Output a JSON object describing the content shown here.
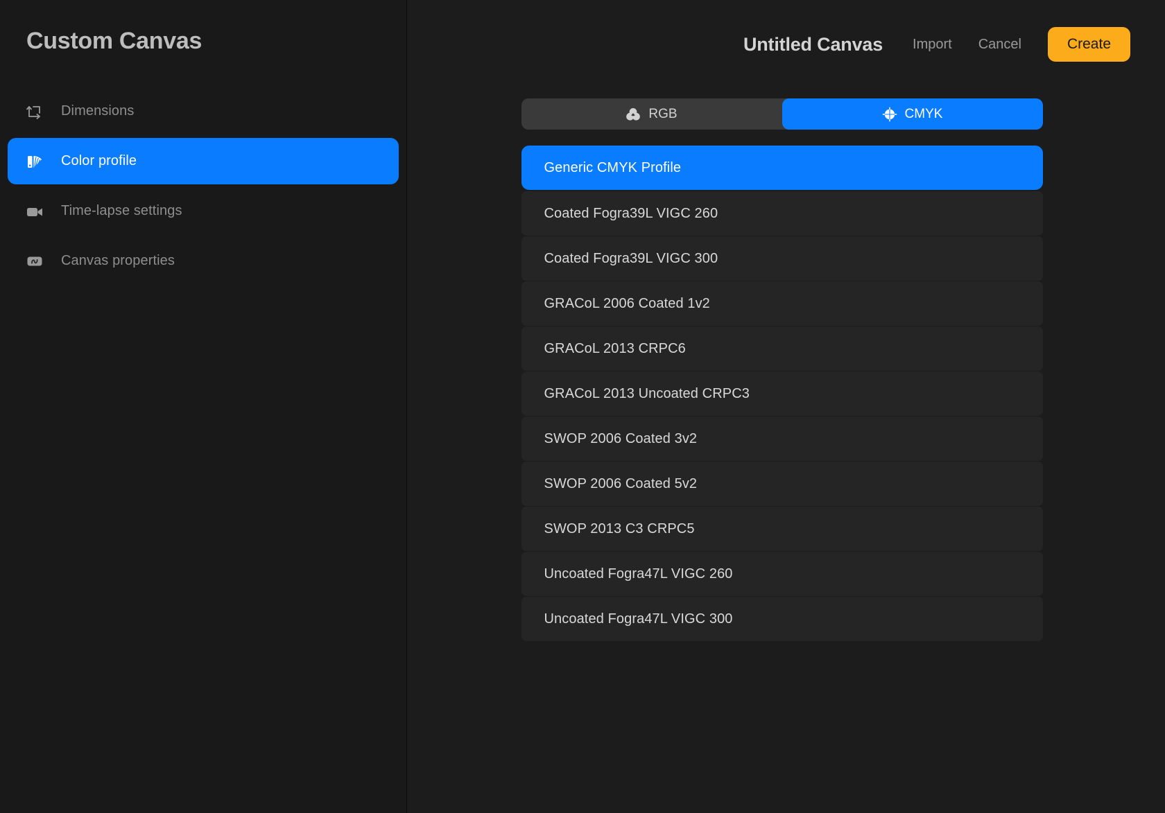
{
  "sidebar": {
    "title": "Custom Canvas",
    "items": [
      {
        "label": "Dimensions",
        "icon": "dimensions-icon",
        "active": false
      },
      {
        "label": "Color profile",
        "icon": "color-profile-icon",
        "active": true
      },
      {
        "label": "Time-lapse settings",
        "icon": "video-camera-icon",
        "active": false
      },
      {
        "label": "Canvas properties",
        "icon": "canvas-properties-icon",
        "active": false
      }
    ]
  },
  "topbar": {
    "canvas_title": "Untitled Canvas",
    "import_label": "Import",
    "cancel_label": "Cancel",
    "create_label": "Create"
  },
  "segmented": {
    "options": [
      {
        "label": "RGB",
        "icon": "rgb-venn-icon",
        "active": false
      },
      {
        "label": "CMYK",
        "icon": "cmyk-registration-icon",
        "active": true
      }
    ]
  },
  "profiles": {
    "selected": "Generic CMYK Profile",
    "items": [
      "Generic CMYK Profile",
      "Coated Fogra39L VIGC 260",
      "Coated Fogra39L VIGC 300",
      "GRACoL 2006 Coated 1v2",
      "GRACoL 2013 CRPC6",
      "GRACoL 2013 Uncoated CRPC3",
      "SWOP 2006 Coated 3v2",
      "SWOP 2006 Coated 5v2",
      "SWOP 2013 C3 CRPC5",
      "Uncoated Fogra47L VIGC 260",
      "Uncoated Fogra47L VIGC 300"
    ]
  },
  "colors": {
    "accent_blue": "#0a7cff",
    "accent_orange": "#fcab1a",
    "background": "#1c1c1c",
    "sidebar_background": "#191919",
    "row_background": "#252525"
  }
}
